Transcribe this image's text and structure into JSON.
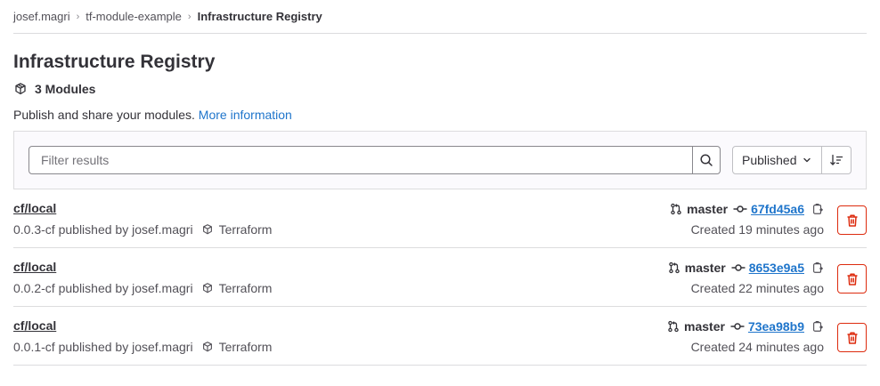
{
  "breadcrumb": [
    "josef.magri",
    "tf-module-example",
    "Infrastructure Registry"
  ],
  "page": {
    "title": "Infrastructure Registry",
    "count": "3 Modules",
    "description": "Publish and share your modules.",
    "more_link": "More information"
  },
  "filter": {
    "placeholder": "Filter results",
    "sort_label": "Published"
  },
  "modules": [
    {
      "name": "cf/local",
      "meta": "0.0.3-cf published by josef.magri",
      "type": "Terraform",
      "branch": "master",
      "sha": "67fd45a6",
      "created": "Created 19 minutes ago"
    },
    {
      "name": "cf/local",
      "meta": "0.0.2-cf published by josef.magri",
      "type": "Terraform",
      "branch": "master",
      "sha": "8653e9a5",
      "created": "Created 22 minutes ago"
    },
    {
      "name": "cf/local",
      "meta": "0.0.1-cf published by josef.magri",
      "type": "Terraform",
      "branch": "master",
      "sha": "73ea98b9",
      "created": "Created 24 minutes ago"
    }
  ],
  "icons": {
    "module": "package-icon",
    "search": "search-icon",
    "chevron": "chevron-down-icon",
    "sort_direction": "sort-lowest-icon",
    "branch": "merge-request-icon",
    "commit": "commit-icon",
    "copy": "copy-icon",
    "delete": "trash-icon"
  },
  "colors": {
    "link": "#1f75cb",
    "danger": "#dd2b0e",
    "border": "#dcdcde",
    "text": "#333238"
  }
}
